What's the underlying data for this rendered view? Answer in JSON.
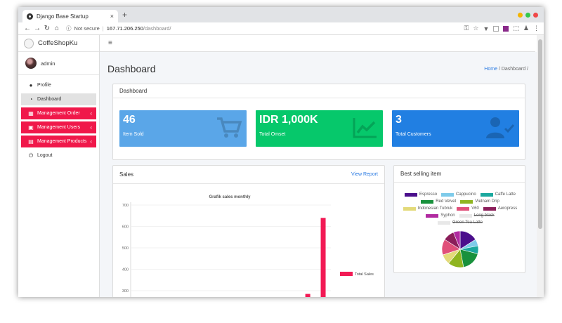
{
  "browser": {
    "tab_title": "Django Base Startup",
    "tab_close": "×",
    "new_tab": "+",
    "not_secure": "Not secure",
    "url_host": "167.71.206.250",
    "url_path": "/dashboard/"
  },
  "sidebar": {
    "brand": "CoffeShopKu",
    "user": "admin",
    "items": [
      {
        "label": "Profile",
        "icon": "user-icon",
        "style": "plain"
      },
      {
        "label": "Dashboard",
        "icon": "dashboard-icon",
        "style": "active"
      },
      {
        "label": "Management Order",
        "icon": "orders-icon",
        "style": "red"
      },
      {
        "label": "Management Users",
        "icon": "users-icon",
        "style": "red"
      },
      {
        "label": "Management Products",
        "icon": "products-icon",
        "style": "red"
      },
      {
        "label": "Logout",
        "icon": "power-icon",
        "style": "plain"
      }
    ]
  },
  "header": {
    "menu_icon": "≡",
    "page_title": "Dashboard",
    "breadcrumb_home": "Home",
    "breadcrumb_sep": "/",
    "breadcrumb_current": "Dashboard",
    "breadcrumb_trailing": "/"
  },
  "summary": {
    "title": "Dashboard",
    "boxes": [
      {
        "value": "46",
        "label": "Item Sold",
        "color": "#5aa6e8",
        "icon": "cart-icon"
      },
      {
        "value": "IDR 1,000K",
        "label": "Total Omset",
        "color": "#06c86b",
        "icon": "chart-line-icon"
      },
      {
        "value": "3",
        "label": "Total Customers",
        "color": "#217fe2",
        "icon": "user-check-icon"
      }
    ]
  },
  "sales": {
    "title": "Sales",
    "link": "View Report"
  },
  "best": {
    "title": "Best selling item"
  },
  "chart_data": [
    {
      "type": "bar",
      "title": "Grafik sales monthly",
      "ylim": [
        200,
        700
      ],
      "yticks": [
        700,
        600,
        500,
        400,
        300
      ],
      "series": [
        {
          "name": "Total Sales",
          "color": "#f21a55",
          "values": [
            0,
            0,
            0,
            0,
            0,
            0,
            0,
            0,
            0,
            0,
            0,
            285,
            640
          ]
        }
      ],
      "grid": true,
      "legend": "right"
    },
    {
      "type": "pie",
      "legend": "top",
      "slices": [
        {
          "name": "Espresso",
          "color": "#4b0f8c",
          "value": 16,
          "strike": false
        },
        {
          "name": "Cappucino",
          "color": "#7ecbea",
          "value": 6,
          "strike": false
        },
        {
          "name": "Caffe Latte",
          "color": "#1aa89e",
          "value": 7,
          "strike": false
        },
        {
          "name": "Red Velvet",
          "color": "#18913c",
          "value": 18,
          "strike": false
        },
        {
          "name": "Vietnam Drip",
          "color": "#8fb520",
          "value": 14,
          "strike": false
        },
        {
          "name": "Indonesian Tubruk",
          "color": "#e3da7a",
          "value": 9,
          "strike": false
        },
        {
          "name": "V60",
          "color": "#e0507a",
          "value": 14,
          "strike": false
        },
        {
          "name": "Aeropress",
          "color": "#8b1e5a",
          "value": 10,
          "strike": false
        },
        {
          "name": "Syphon",
          "color": "#b12aa0",
          "value": 6,
          "strike": false
        },
        {
          "name": "Long black",
          "color": "#e8e8e8",
          "value": 0,
          "strike": true
        },
        {
          "name": "Green Tea Latte",
          "color": "#e8e8e8",
          "value": 0,
          "strike": true
        }
      ]
    }
  ]
}
